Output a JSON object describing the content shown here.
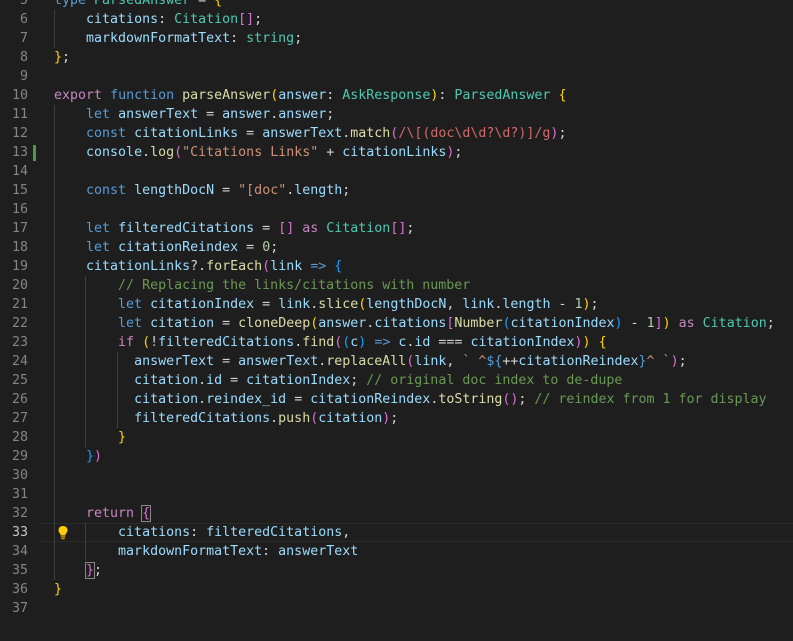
{
  "editor": {
    "language": "typescript",
    "active_line": 33,
    "modified_line": 13,
    "lightbulb_line": 33,
    "colors": {
      "background": "#1e1e1e",
      "keyword": "#569cd6",
      "control": "#c586c0",
      "type": "#4ec9b0",
      "variable": "#9cdcfe",
      "function": "#dcdcaa",
      "string": "#ce9178",
      "number": "#b5cea8",
      "comment": "#6a9955",
      "regex": "#d16969"
    },
    "lines": [
      {
        "num": "5",
        "tokens": [
          [
            "kw",
            "type"
          ],
          [
            "op",
            " "
          ],
          [
            "type",
            "ParsedAnswer"
          ],
          [
            "op",
            " = "
          ],
          [
            "b1",
            "{"
          ]
        ]
      },
      {
        "num": "6",
        "tokens": [
          [
            "op",
            "    "
          ],
          [
            "var",
            "citations"
          ],
          [
            "op",
            ": "
          ],
          [
            "type",
            "Citation"
          ],
          [
            "b2",
            "[]"
          ],
          [
            "op",
            ";"
          ]
        ]
      },
      {
        "num": "7",
        "tokens": [
          [
            "op",
            "    "
          ],
          [
            "var",
            "markdownFormatText"
          ],
          [
            "op",
            ": "
          ],
          [
            "type",
            "string"
          ],
          [
            "op",
            ";"
          ]
        ]
      },
      {
        "num": "8",
        "tokens": [
          [
            "b1",
            "}"
          ],
          [
            "op",
            ";"
          ]
        ]
      },
      {
        "num": "9",
        "tokens": []
      },
      {
        "num": "10",
        "tokens": [
          [
            "ctl",
            "export"
          ],
          [
            "op",
            " "
          ],
          [
            "kw",
            "function"
          ],
          [
            "op",
            " "
          ],
          [
            "fn",
            "parseAnswer"
          ],
          [
            "b1",
            "("
          ],
          [
            "var",
            "answer"
          ],
          [
            "op",
            ": "
          ],
          [
            "type",
            "AskResponse"
          ],
          [
            "b1",
            ")"
          ],
          [
            "op",
            ": "
          ],
          [
            "type",
            "ParsedAnswer"
          ],
          [
            "op",
            " "
          ],
          [
            "b1",
            "{"
          ]
        ]
      },
      {
        "num": "11",
        "tokens": [
          [
            "op",
            "    "
          ],
          [
            "kw",
            "let"
          ],
          [
            "op",
            " "
          ],
          [
            "var",
            "answerText"
          ],
          [
            "op",
            " = "
          ],
          [
            "var",
            "answer"
          ],
          [
            "op",
            "."
          ],
          [
            "var",
            "answer"
          ],
          [
            "op",
            ";"
          ]
        ]
      },
      {
        "num": "12",
        "tokens": [
          [
            "op",
            "    "
          ],
          [
            "kw",
            "const"
          ],
          [
            "op",
            " "
          ],
          [
            "var",
            "citationLinks"
          ],
          [
            "op",
            " = "
          ],
          [
            "var",
            "answerText"
          ],
          [
            "op",
            "."
          ],
          [
            "fn",
            "match"
          ],
          [
            "b2",
            "("
          ],
          [
            "regex",
            "/\\[(doc\\d\\d?\\d?)]/g"
          ],
          [
            "b2",
            ")"
          ],
          [
            "op",
            ";"
          ]
        ]
      },
      {
        "num": "13",
        "tokens": [
          [
            "op",
            "    "
          ],
          [
            "var",
            "console"
          ],
          [
            "op",
            "."
          ],
          [
            "fn",
            "log"
          ],
          [
            "b2",
            "("
          ],
          [
            "str",
            "\"Citations Links\""
          ],
          [
            "op",
            " + "
          ],
          [
            "var",
            "citationLinks"
          ],
          [
            "b2",
            ")"
          ],
          [
            "op",
            ";"
          ]
        ]
      },
      {
        "num": "14",
        "tokens": []
      },
      {
        "num": "15",
        "tokens": [
          [
            "op",
            "    "
          ],
          [
            "kw",
            "const"
          ],
          [
            "op",
            " "
          ],
          [
            "var",
            "lengthDocN"
          ],
          [
            "op",
            " = "
          ],
          [
            "str",
            "\"[doc\""
          ],
          [
            "op",
            "."
          ],
          [
            "var",
            "length"
          ],
          [
            "op",
            ";"
          ]
        ]
      },
      {
        "num": "16",
        "tokens": []
      },
      {
        "num": "17",
        "tokens": [
          [
            "op",
            "    "
          ],
          [
            "kw",
            "let"
          ],
          [
            "op",
            " "
          ],
          [
            "var",
            "filteredCitations"
          ],
          [
            "op",
            " = "
          ],
          [
            "b2",
            "[]"
          ],
          [
            "op",
            " "
          ],
          [
            "ctl",
            "as"
          ],
          [
            "op",
            " "
          ],
          [
            "type",
            "Citation"
          ],
          [
            "b2",
            "[]"
          ],
          [
            "op",
            ";"
          ]
        ]
      },
      {
        "num": "18",
        "tokens": [
          [
            "op",
            "    "
          ],
          [
            "kw",
            "let"
          ],
          [
            "op",
            " "
          ],
          [
            "var",
            "citationReindex"
          ],
          [
            "op",
            " = "
          ],
          [
            "num",
            "0"
          ],
          [
            "op",
            ";"
          ]
        ]
      },
      {
        "num": "19",
        "tokens": [
          [
            "op",
            "    "
          ],
          [
            "var",
            "citationLinks"
          ],
          [
            "op",
            "?."
          ],
          [
            "fn",
            "forEach"
          ],
          [
            "b2",
            "("
          ],
          [
            "var",
            "link"
          ],
          [
            "op",
            " "
          ],
          [
            "kw",
            "=>"
          ],
          [
            "op",
            " "
          ],
          [
            "b3",
            "{"
          ]
        ]
      },
      {
        "num": "20",
        "tokens": [
          [
            "op",
            "        "
          ],
          [
            "cmt",
            "// Replacing the links/citations with number"
          ]
        ]
      },
      {
        "num": "21",
        "tokens": [
          [
            "op",
            "        "
          ],
          [
            "kw",
            "let"
          ],
          [
            "op",
            " "
          ],
          [
            "var",
            "citationIndex"
          ],
          [
            "op",
            " = "
          ],
          [
            "var",
            "link"
          ],
          [
            "op",
            "."
          ],
          [
            "fn",
            "slice"
          ],
          [
            "b1",
            "("
          ],
          [
            "var",
            "lengthDocN"
          ],
          [
            "op",
            ", "
          ],
          [
            "var",
            "link"
          ],
          [
            "op",
            "."
          ],
          [
            "var",
            "length"
          ],
          [
            "op",
            " - "
          ],
          [
            "num",
            "1"
          ],
          [
            "b1",
            ")"
          ],
          [
            "op",
            ";"
          ]
        ]
      },
      {
        "num": "22",
        "tokens": [
          [
            "op",
            "        "
          ],
          [
            "kw",
            "let"
          ],
          [
            "op",
            " "
          ],
          [
            "var",
            "citation"
          ],
          [
            "op",
            " = "
          ],
          [
            "fn",
            "cloneDeep"
          ],
          [
            "b1",
            "("
          ],
          [
            "var",
            "answer"
          ],
          [
            "op",
            "."
          ],
          [
            "var",
            "citations"
          ],
          [
            "b2",
            "["
          ],
          [
            "fn",
            "Number"
          ],
          [
            "b3",
            "("
          ],
          [
            "var",
            "citationIndex"
          ],
          [
            "b3",
            ")"
          ],
          [
            "op",
            " - "
          ],
          [
            "num",
            "1"
          ],
          [
            "b2",
            "]"
          ],
          [
            "b1",
            ")"
          ],
          [
            "op",
            " "
          ],
          [
            "ctl",
            "as"
          ],
          [
            "op",
            " "
          ],
          [
            "type",
            "Citation"
          ],
          [
            "op",
            ";"
          ]
        ]
      },
      {
        "num": "23",
        "tokens": [
          [
            "op",
            "        "
          ],
          [
            "ctl",
            "if"
          ],
          [
            "op",
            " "
          ],
          [
            "b1",
            "("
          ],
          [
            "op",
            "!"
          ],
          [
            "var",
            "filteredCitations"
          ],
          [
            "op",
            "."
          ],
          [
            "fn",
            "find"
          ],
          [
            "b2",
            "("
          ],
          [
            "b3",
            "("
          ],
          [
            "var",
            "c"
          ],
          [
            "b3",
            ")"
          ],
          [
            "op",
            " "
          ],
          [
            "kw",
            "=>"
          ],
          [
            "op",
            " "
          ],
          [
            "var",
            "c"
          ],
          [
            "op",
            "."
          ],
          [
            "var",
            "id"
          ],
          [
            "op",
            " === "
          ],
          [
            "var",
            "citationIndex"
          ],
          [
            "b2",
            ")"
          ],
          [
            "b1",
            ")"
          ],
          [
            "op",
            " "
          ],
          [
            "b1",
            "{"
          ]
        ]
      },
      {
        "num": "24",
        "tokens": [
          [
            "op",
            "          "
          ],
          [
            "var",
            "answerText"
          ],
          [
            "op",
            " = "
          ],
          [
            "var",
            "answerText"
          ],
          [
            "op",
            "."
          ],
          [
            "fn",
            "replaceAll"
          ],
          [
            "b2",
            "("
          ],
          [
            "var",
            "link"
          ],
          [
            "op",
            ", "
          ],
          [
            "str",
            "` ^"
          ],
          [
            "kw",
            "${"
          ],
          [
            "op",
            "++"
          ],
          [
            "var",
            "citationReindex"
          ],
          [
            "kw",
            "}"
          ],
          [
            "str",
            "^ `"
          ],
          [
            "b2",
            ")"
          ],
          [
            "op",
            ";"
          ]
        ]
      },
      {
        "num": "25",
        "tokens": [
          [
            "op",
            "          "
          ],
          [
            "var",
            "citation"
          ],
          [
            "op",
            "."
          ],
          [
            "var",
            "id"
          ],
          [
            "op",
            " = "
          ],
          [
            "var",
            "citationIndex"
          ],
          [
            "op",
            "; "
          ],
          [
            "cmt",
            "// original doc index to de-dupe"
          ]
        ]
      },
      {
        "num": "26",
        "tokens": [
          [
            "op",
            "          "
          ],
          [
            "var",
            "citation"
          ],
          [
            "op",
            "."
          ],
          [
            "var",
            "reindex_id"
          ],
          [
            "op",
            " = "
          ],
          [
            "var",
            "citationReindex"
          ],
          [
            "op",
            "."
          ],
          [
            "fn",
            "toString"
          ],
          [
            "b2",
            "()"
          ],
          [
            "op",
            "; "
          ],
          [
            "cmt",
            "// reindex from 1 for display"
          ]
        ]
      },
      {
        "num": "27",
        "tokens": [
          [
            "op",
            "          "
          ],
          [
            "var",
            "filteredCitations"
          ],
          [
            "op",
            "."
          ],
          [
            "fn",
            "push"
          ],
          [
            "b2",
            "("
          ],
          [
            "var",
            "citation"
          ],
          [
            "b2",
            ")"
          ],
          [
            "op",
            ";"
          ]
        ]
      },
      {
        "num": "28",
        "tokens": [
          [
            "op",
            "        "
          ],
          [
            "b1",
            "}"
          ]
        ]
      },
      {
        "num": "29",
        "tokens": [
          [
            "op",
            "    "
          ],
          [
            "b3",
            "}"
          ],
          [
            "b2",
            ")"
          ]
        ]
      },
      {
        "num": "30",
        "tokens": []
      },
      {
        "num": "31",
        "tokens": []
      },
      {
        "num": "32",
        "tokens": [
          [
            "op",
            "    "
          ],
          [
            "ctl",
            "return"
          ],
          [
            "op",
            " "
          ],
          [
            "b2m",
            "{"
          ]
        ]
      },
      {
        "num": "33",
        "tokens": [
          [
            "op",
            "        "
          ],
          [
            "var",
            "citations"
          ],
          [
            "op",
            ": "
          ],
          [
            "var",
            "filteredCitations"
          ],
          [
            "op",
            ","
          ]
        ]
      },
      {
        "num": "34",
        "tokens": [
          [
            "op",
            "        "
          ],
          [
            "var",
            "markdownFormatText"
          ],
          [
            "op",
            ": "
          ],
          [
            "var",
            "answerText"
          ]
        ]
      },
      {
        "num": "35",
        "tokens": [
          [
            "op",
            "    "
          ],
          [
            "b2m",
            "}"
          ],
          [
            "op",
            ";"
          ]
        ]
      },
      {
        "num": "36",
        "tokens": [
          [
            "b1",
            "}"
          ]
        ]
      },
      {
        "num": "37",
        "tokens": []
      }
    ]
  }
}
